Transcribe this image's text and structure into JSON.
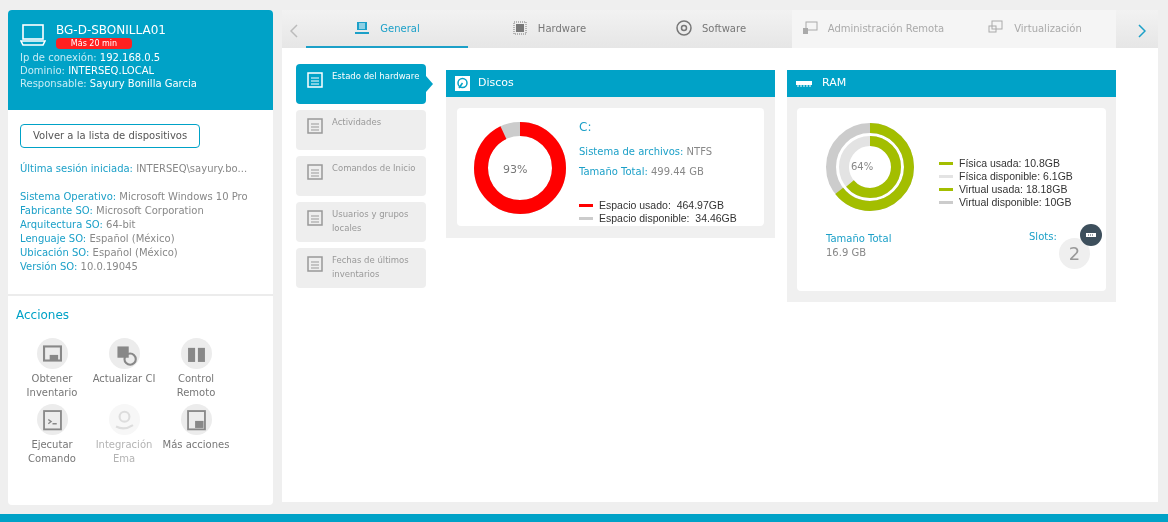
{
  "device": {
    "name": "BG-D-SBONILLA01",
    "badge": "Más 20 min",
    "fields": [
      {
        "label": "Ip de conexión:",
        "value": "192.168.0.5"
      },
      {
        "label": "Dominio:",
        "value": "INTERSEQ.LOCAL"
      },
      {
        "label": "Responsable:",
        "value": "Sayury Bonilla Garcia"
      }
    ]
  },
  "back_button": "Volver a la lista de dispositivos",
  "last_session": {
    "label": "Última sesión iniciada:",
    "value": "INTERSEQ\\sayury.bo..."
  },
  "os_info": [
    {
      "label": "Sistema Operativo:",
      "value": "Microsoft Windows 10 Pro"
    },
    {
      "label": "Fabricante SO:",
      "value": "Microsoft Corporation"
    },
    {
      "label": "Arquitectura SO:",
      "value": "64-bit"
    },
    {
      "label": "Lenguaje SO:",
      "value": "Español (México)"
    },
    {
      "label": "Ubicación SO:",
      "value": "Español (México)"
    },
    {
      "label": "Versión SO:",
      "value": "10.0.19045"
    }
  ],
  "actions": {
    "title": "Acciones",
    "items": [
      {
        "label": "Obtener Inventario",
        "disabled": false
      },
      {
        "label": "Actualizar CI",
        "disabled": false
      },
      {
        "label": "Control Remoto",
        "disabled": false
      },
      {
        "label": "Ejecutar Comando",
        "disabled": false
      },
      {
        "label": "Integración Ema",
        "disabled": true
      },
      {
        "label": "Más acciones",
        "disabled": false
      }
    ]
  },
  "tabs": [
    {
      "label": "General",
      "selected": true,
      "disabled": false
    },
    {
      "label": "Hardware",
      "selected": false,
      "disabled": false
    },
    {
      "label": "Software",
      "selected": false,
      "disabled": false
    },
    {
      "label": "Administración Remota",
      "selected": false,
      "disabled": true
    },
    {
      "label": "Virtualización",
      "selected": false,
      "disabled": true
    }
  ],
  "side_menu": [
    {
      "label": "Estado del hardware",
      "selected": true
    },
    {
      "label": "Actividades",
      "selected": false
    },
    {
      "label": "Comandos de Inicio",
      "selected": false
    },
    {
      "label": "Usuarios y grupos locales",
      "selected": false
    },
    {
      "label": "Fechas de últimos inventarios",
      "selected": false
    }
  ],
  "disks": {
    "title": "Discos",
    "drive": "C:",
    "percent": "93%",
    "level": 0.93,
    "fields": [
      {
        "label": "Sistema de archivos:",
        "value": "NTFS"
      },
      {
        "label": "Tamaño Total:",
        "value": "499.44 GB"
      }
    ],
    "legend": [
      {
        "text": "Espacio usado:  464.97GB",
        "color": "#ff0000"
      },
      {
        "text": "Espacio disponible:  34.46GB",
        "color": "#cccccc"
      }
    ]
  },
  "ram": {
    "title": "RAM",
    "percent": "64%",
    "physical": {
      "level": 0.64
    },
    "virtual": {
      "level": 0.645
    },
    "legend": [
      {
        "text": "Física usada: 10.8GB",
        "color": "#a3be00"
      },
      {
        "text": "Física disponible: 6.1GB",
        "color": "#e3e3e3"
      },
      {
        "text": "Virtual usada: 18.18GB",
        "color": "#a3be00"
      },
      {
        "text": "Virtual disponible: 10GB",
        "color": "#cccccc"
      }
    ],
    "total_label": "Tamaño Total",
    "total_value": "16.9 GB",
    "slots_label": "Slots:",
    "slots_value": "2"
  }
}
